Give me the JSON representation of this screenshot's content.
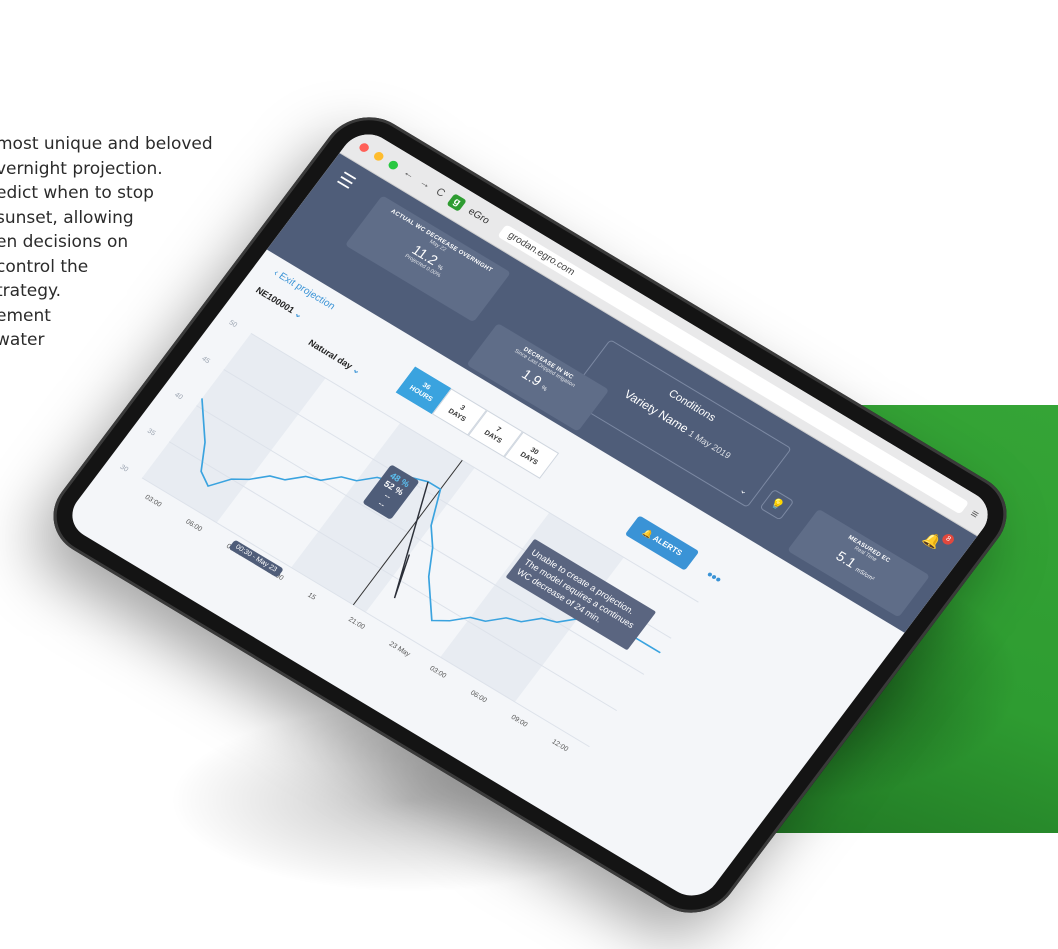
{
  "marketing_copy": [
    "most unique and beloved",
    "vernight projection.",
    "edict when to stop",
    "sunset, allowing",
    "en decisions on",
    "control the",
    "trategy.",
    "ement",
    "water"
  ],
  "browser": {
    "tab_title": "eGro",
    "favicon_letter": "g",
    "url": "grodan.egro.com"
  },
  "header": {
    "actual_wc": {
      "label": "ACTUAL WC DECREASE OVERNIGHT",
      "sub": "May 22",
      "value": "11.2",
      "unit": "%",
      "foot": "Projected 0.00%"
    },
    "conditions": {
      "title": "Conditions",
      "variety": "Variety Name",
      "date": "1 May 2019"
    },
    "decrease_wc": {
      "label": "DECREASE IN WC",
      "sub": "Since Last Dripped Irrigation",
      "value": "1.9",
      "unit": "%"
    },
    "measured_ec": {
      "label": "MEASURED EC",
      "sub": "Real Time",
      "value": "5.1",
      "unit": "mS/cm²"
    },
    "alert_badge": "8"
  },
  "controls": {
    "exit_projection": "Exit projection",
    "station": "NE100001",
    "day_mode": "Natural day",
    "ranges": [
      {
        "top": "36",
        "bottom": "HOURS",
        "active": true
      },
      {
        "top": "3",
        "bottom": "DAYS",
        "active": false
      },
      {
        "top": "7",
        "bottom": "DAYS",
        "active": false
      },
      {
        "top": "30",
        "bottom": "DAYS",
        "active": false
      }
    ],
    "alerts_label": "ALERTS",
    "more": "•••"
  },
  "chart_data": {
    "type": "line",
    "y_ticks": [
      "50",
      "45",
      "40",
      "35",
      "30"
    ],
    "ylim": [
      30,
      50
    ],
    "x_ticks": [
      "03:00",
      "06:00",
      "09:00",
      "12:00",
      "15",
      "21:00",
      "23 May",
      "03:00",
      "06:00",
      "09:00",
      "12:00"
    ],
    "series": [
      {
        "x": [
          0,
          1,
          2,
          3,
          4,
          5,
          6,
          7,
          8,
          9,
          10,
          11,
          12,
          13,
          14,
          15,
          16,
          17,
          18,
          19,
          20,
          21,
          22,
          23,
          24,
          25,
          26,
          27,
          28,
          29,
          30,
          31,
          32,
          33,
          34,
          35,
          36
        ],
        "values": [
          41,
          39,
          37,
          34,
          33,
          35,
          36,
          37.5,
          38,
          39.5,
          40,
          41.5,
          42,
          43.5,
          44,
          45.5,
          46,
          46,
          42,
          40,
          37,
          35,
          33,
          34,
          35.5,
          36,
          37.5,
          38,
          39.5,
          40,
          41.5,
          42,
          43,
          43,
          43,
          43,
          43
        ]
      }
    ],
    "tooltip": {
      "primary": "48 %",
      "secondary": "52 %",
      "line3": "--",
      "line4": "--"
    },
    "cursor_time": "00:30 - May 23",
    "warning": "Unable to create a projection. The model requires a continues WC decrease of 24 min."
  }
}
